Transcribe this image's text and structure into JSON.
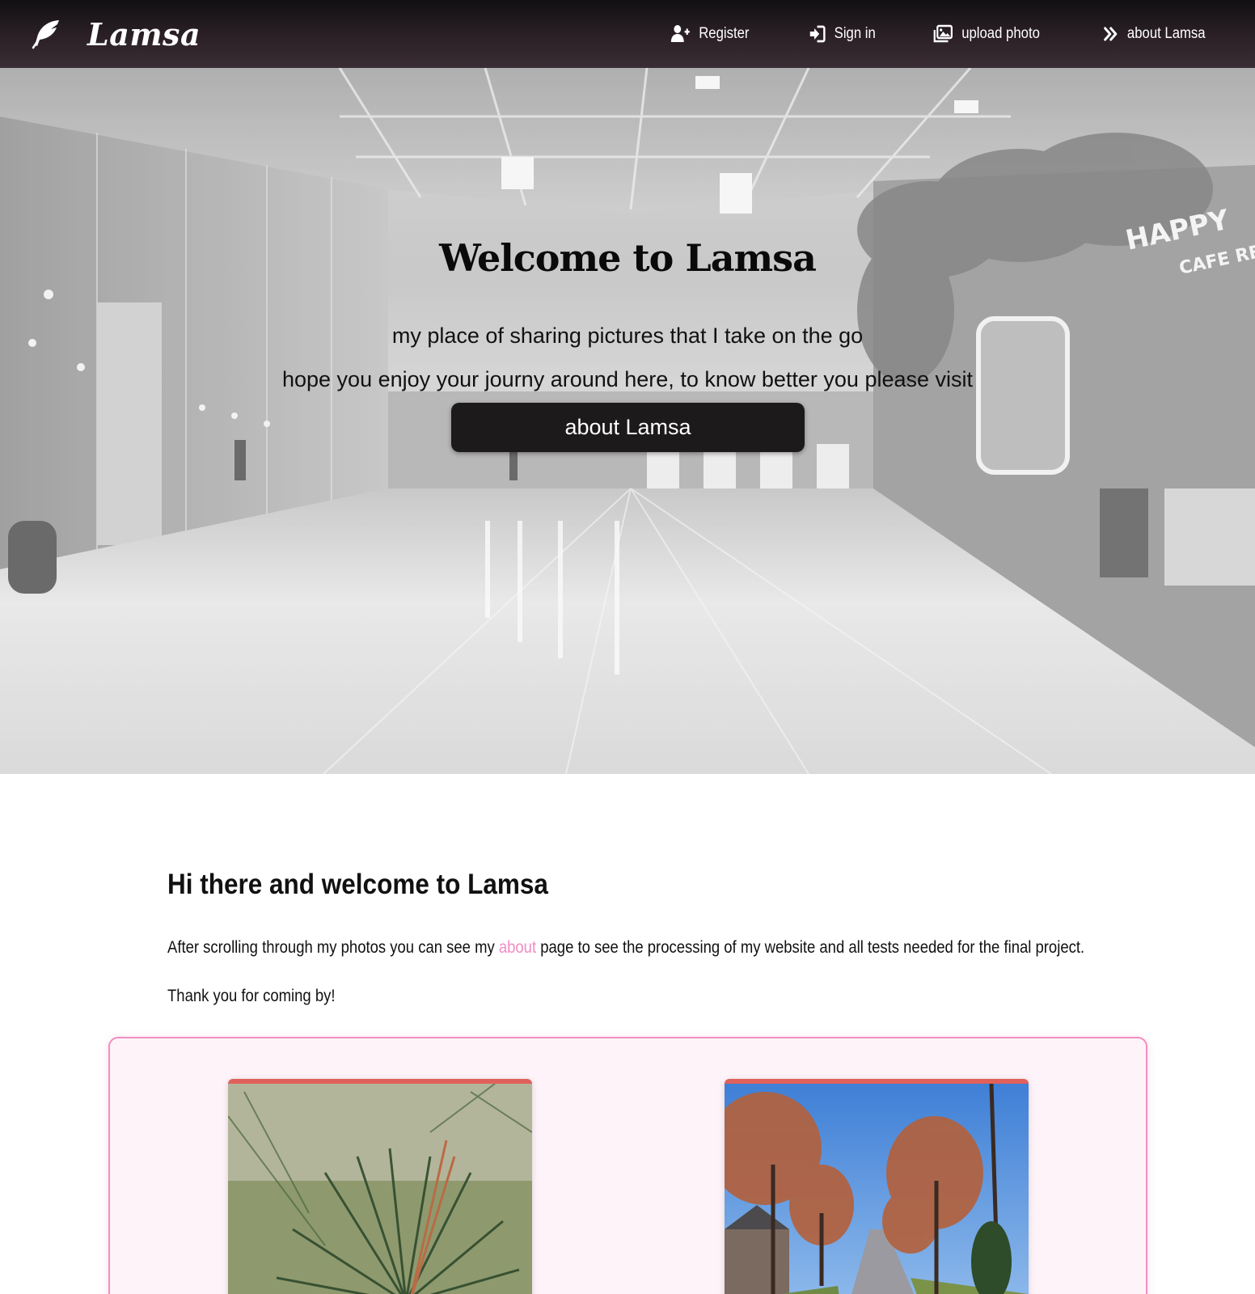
{
  "nav": {
    "brand": "Lamsa",
    "links": [
      {
        "label": "Register",
        "icon": "user-plus-icon"
      },
      {
        "label": "Sign in",
        "icon": "sign-in-icon"
      },
      {
        "label": "upload photo",
        "icon": "images-icon"
      },
      {
        "label": "about Lamsa",
        "icon": "double-chevron-right-icon"
      }
    ]
  },
  "hero": {
    "title": "Welcome to Lamsa",
    "line1": "my place of sharing pictures that I take on the go",
    "line2": "hope you enjoy your journy around here, to know better you please visit",
    "button": "about Lamsa"
  },
  "intro": {
    "heading": "Hi there and welcome to Lamsa",
    "p1_before": "After scrolling through my photos you can see my ",
    "p1_link": "about",
    "p1_after": " page to see the processing of my website and all tests needed for the final project.",
    "p2": "Thank you for coming by!"
  },
  "colors": {
    "nav_bg": "#2d2228",
    "accent_pink": "#f08cc5",
    "gallery_bg": "#fdf3f8",
    "card_top": "#e0615c",
    "button_bg": "#1c1a1b"
  }
}
